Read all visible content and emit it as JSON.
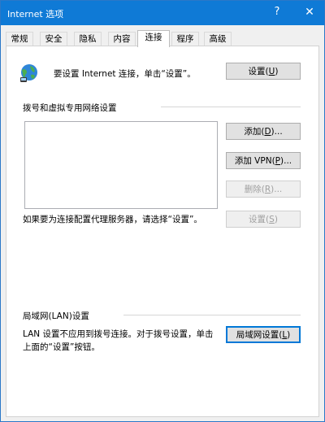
{
  "window": {
    "title": "Internet 选项",
    "help_label": "?",
    "close_label": "✕"
  },
  "tabs": [
    {
      "label": "常规"
    },
    {
      "label": "安全"
    },
    {
      "label": "隐私"
    },
    {
      "label": "内容"
    },
    {
      "label": "连接",
      "active": true
    },
    {
      "label": "程序"
    },
    {
      "label": "高级"
    }
  ],
  "connection": {
    "globe_icon": "network-globe-icon",
    "setup_text": "要设置 Internet 连接，单击“设置”。",
    "setup_button": {
      "label": "设置",
      "mnemonic": "U"
    }
  },
  "dialup": {
    "section_label": "拨号和虚拟专用网络设置",
    "connections_list": [],
    "add_button": {
      "label": "添加",
      "mnemonic": "D",
      "suffix": "..."
    },
    "add_vpn_button": {
      "label": "添加 VPN",
      "mnemonic": "P",
      "suffix": "..."
    },
    "remove_button": {
      "label": "删除",
      "mnemonic": "R",
      "suffix": "..."
    },
    "proxy_note": "如果要为连接配置代理服务器，请选择“设置”。",
    "settings_button": {
      "label": "设置",
      "mnemonic": "S"
    }
  },
  "lan": {
    "section_label": "局域网(LAN)设置",
    "note_line1": "LAN 设置不应用到拨号连接。对于拨号设置，单击",
    "note_line2": "上面的“设置”按钮。",
    "lan_settings_button": {
      "label": "局域网设置",
      "mnemonic": "L"
    }
  },
  "colors": {
    "title_bar": "#0f7ad6",
    "panel_bg": "#ffffff",
    "button_bg": "#e1e1e1",
    "focus_border": "#0078d7",
    "disabled_text": "#a0a0a0"
  }
}
